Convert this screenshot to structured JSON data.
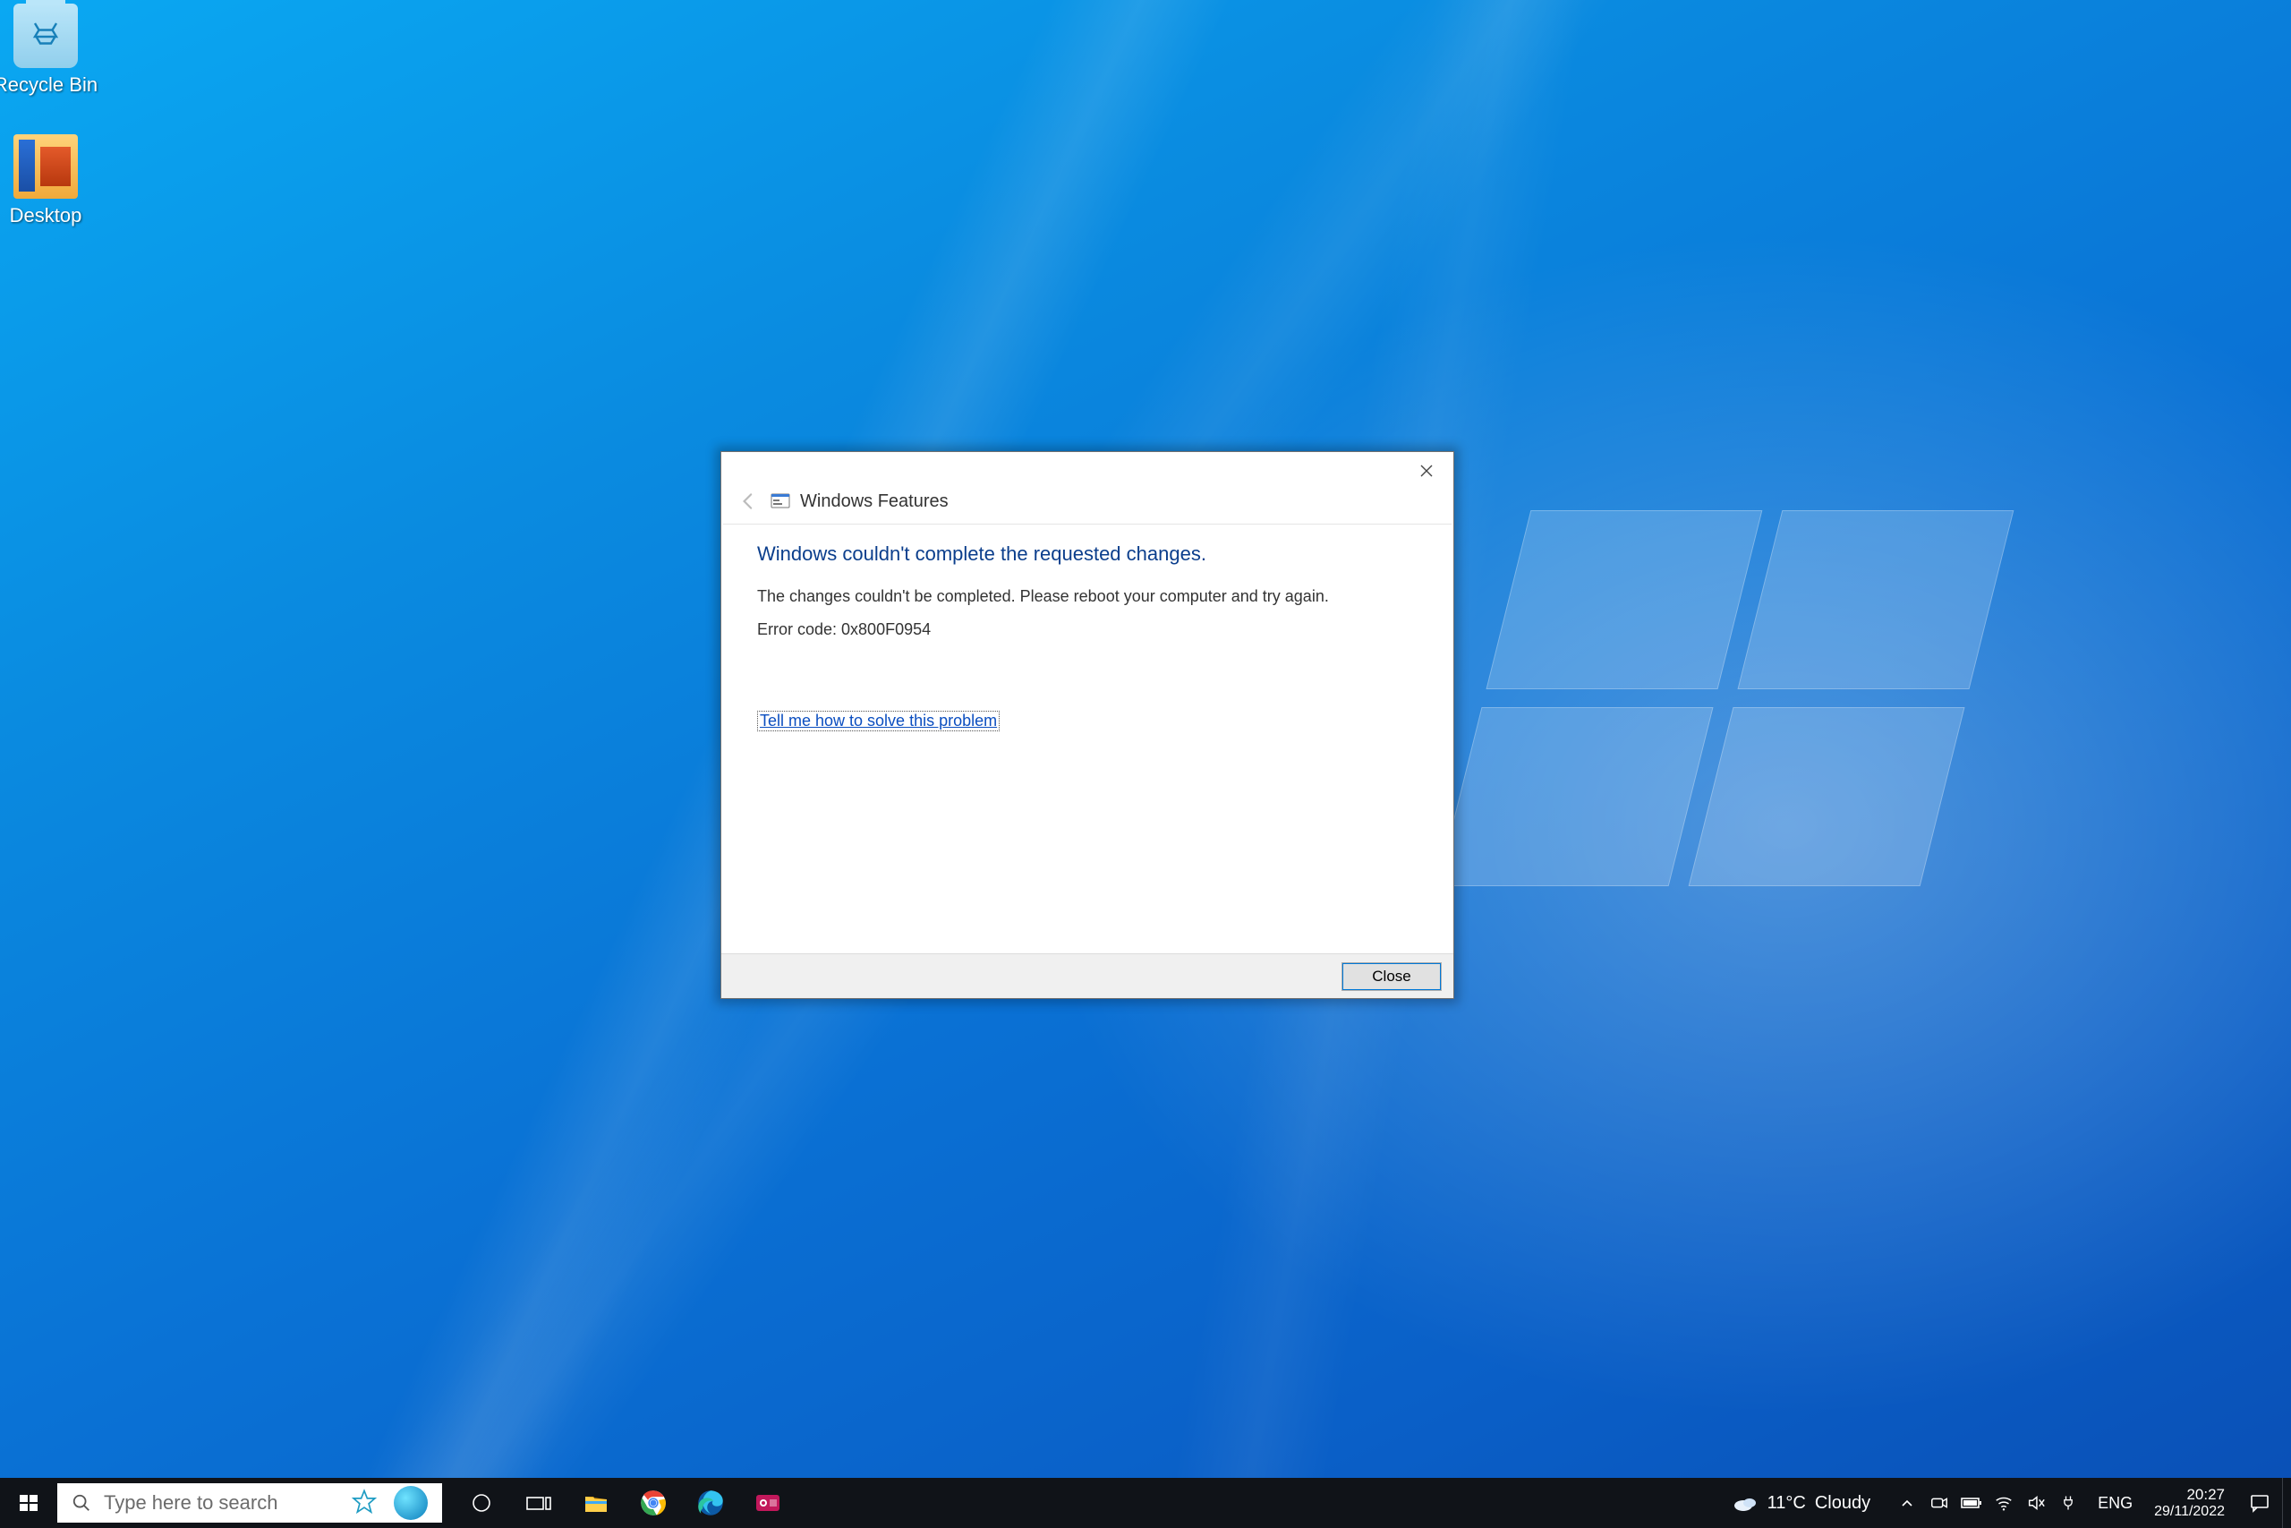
{
  "desktop_icons": {
    "recycle_bin": "Recycle Bin",
    "desktop": "Desktop"
  },
  "dialog": {
    "title": "Windows Features",
    "heading": "Windows couldn't complete the requested changes.",
    "message": "The changes couldn't be completed. Please reboot your computer and try again.",
    "error": "Error code: 0x800F0954",
    "link": "Tell me how to solve this problem",
    "close_btn": "Close"
  },
  "taskbar": {
    "search_placeholder": "Type here to search",
    "weather_temp": "11°C",
    "weather_cond": "Cloudy",
    "lang": "ENG",
    "time": "20:27",
    "date": "29/11/2022"
  }
}
